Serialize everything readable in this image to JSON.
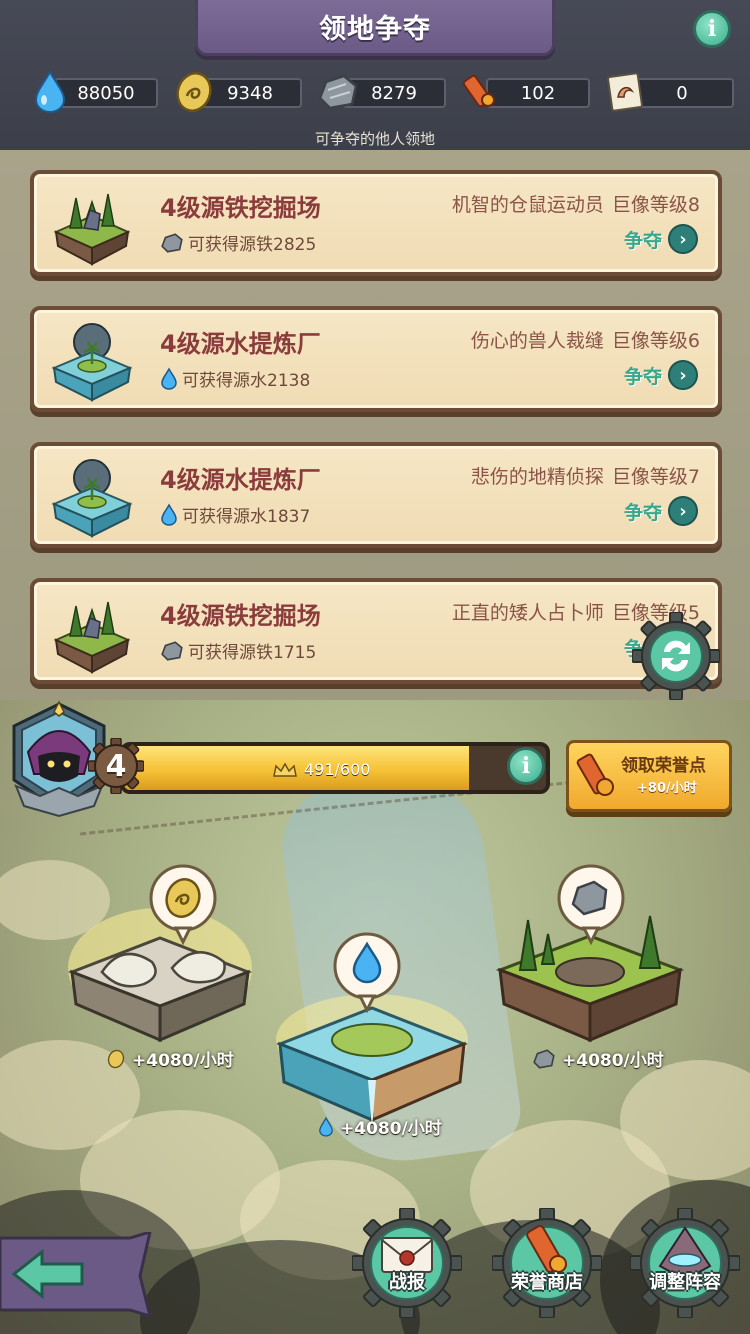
{
  "header": {
    "title": "领地争夺",
    "subtitle": "可争夺的他人领地"
  },
  "resources": [
    {
      "icon": "water-drop-icon",
      "value": "88050"
    },
    {
      "icon": "gold-coin-icon",
      "value": "9348"
    },
    {
      "icon": "iron-ore-icon",
      "value": "8279"
    },
    {
      "icon": "honor-scroll-icon",
      "value": "102"
    },
    {
      "icon": "muscle-card-icon",
      "value": "0"
    }
  ],
  "territories": [
    {
      "title": "4级源铁挖掘场",
      "reward_icon": "iron-ore-icon",
      "reward": "可获得源铁2825",
      "owner": "机智的仓鼠运动员",
      "level": "巨像等级8",
      "action": "争夺"
    },
    {
      "title": "4级源水提炼厂",
      "reward_icon": "water-drop-icon",
      "reward": "可获得源水2138",
      "owner": "伤心的兽人裁缝",
      "level": "巨像等级6",
      "action": "争夺"
    },
    {
      "title": "4级源水提炼厂",
      "reward_icon": "water-drop-icon",
      "reward": "可获得源水1837",
      "owner": "悲伤的地精侦探",
      "level": "巨像等级7",
      "action": "争夺"
    },
    {
      "title": "4级源铁挖掘场",
      "reward_icon": "iron-ore-icon",
      "reward": "可获得源铁1715",
      "owner": "正直的矮人占卜师",
      "level": "巨像等级5",
      "action": "争夺"
    }
  ],
  "player": {
    "level": "4",
    "xp_text": "491/600",
    "xp_fraction": 0.818
  },
  "honor_button": {
    "label": "领取荣誉点",
    "rate": "+80/小时"
  },
  "islands": [
    {
      "name": "gold",
      "icon": "gold-coin-icon",
      "production": "+4080/小时"
    },
    {
      "name": "water",
      "icon": "water-drop-icon",
      "production": "+4080/小时"
    },
    {
      "name": "iron",
      "icon": "iron-ore-icon",
      "production": "+4080/小时"
    }
  ],
  "nav": {
    "battle_report": "战报",
    "honor_shop": "荣誉商店",
    "adjust_lineup": "调整阵容"
  },
  "colors": {
    "accent_green": "#3aa88a",
    "card_title": "#8a3c3c",
    "xp_gold": "#f6c236"
  }
}
